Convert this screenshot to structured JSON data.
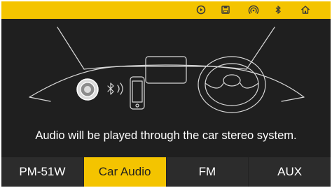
{
  "status_bar": {
    "icons": [
      "play-circle-icon",
      "save-icon",
      "signal-icon",
      "bluetooth-icon",
      "home-icon"
    ]
  },
  "main": {
    "message": "Audio will be played through the car stereo system."
  },
  "tabs": [
    {
      "label": "PM-51W",
      "active": false
    },
    {
      "label": "Car Audio",
      "active": true
    },
    {
      "label": "FM",
      "active": false
    },
    {
      "label": "AUX",
      "active": false
    }
  ],
  "colors": {
    "accent": "#f4c400",
    "background": "#1f1f1f",
    "tab_background": "#2c2c2c",
    "text": "#ffffff"
  }
}
